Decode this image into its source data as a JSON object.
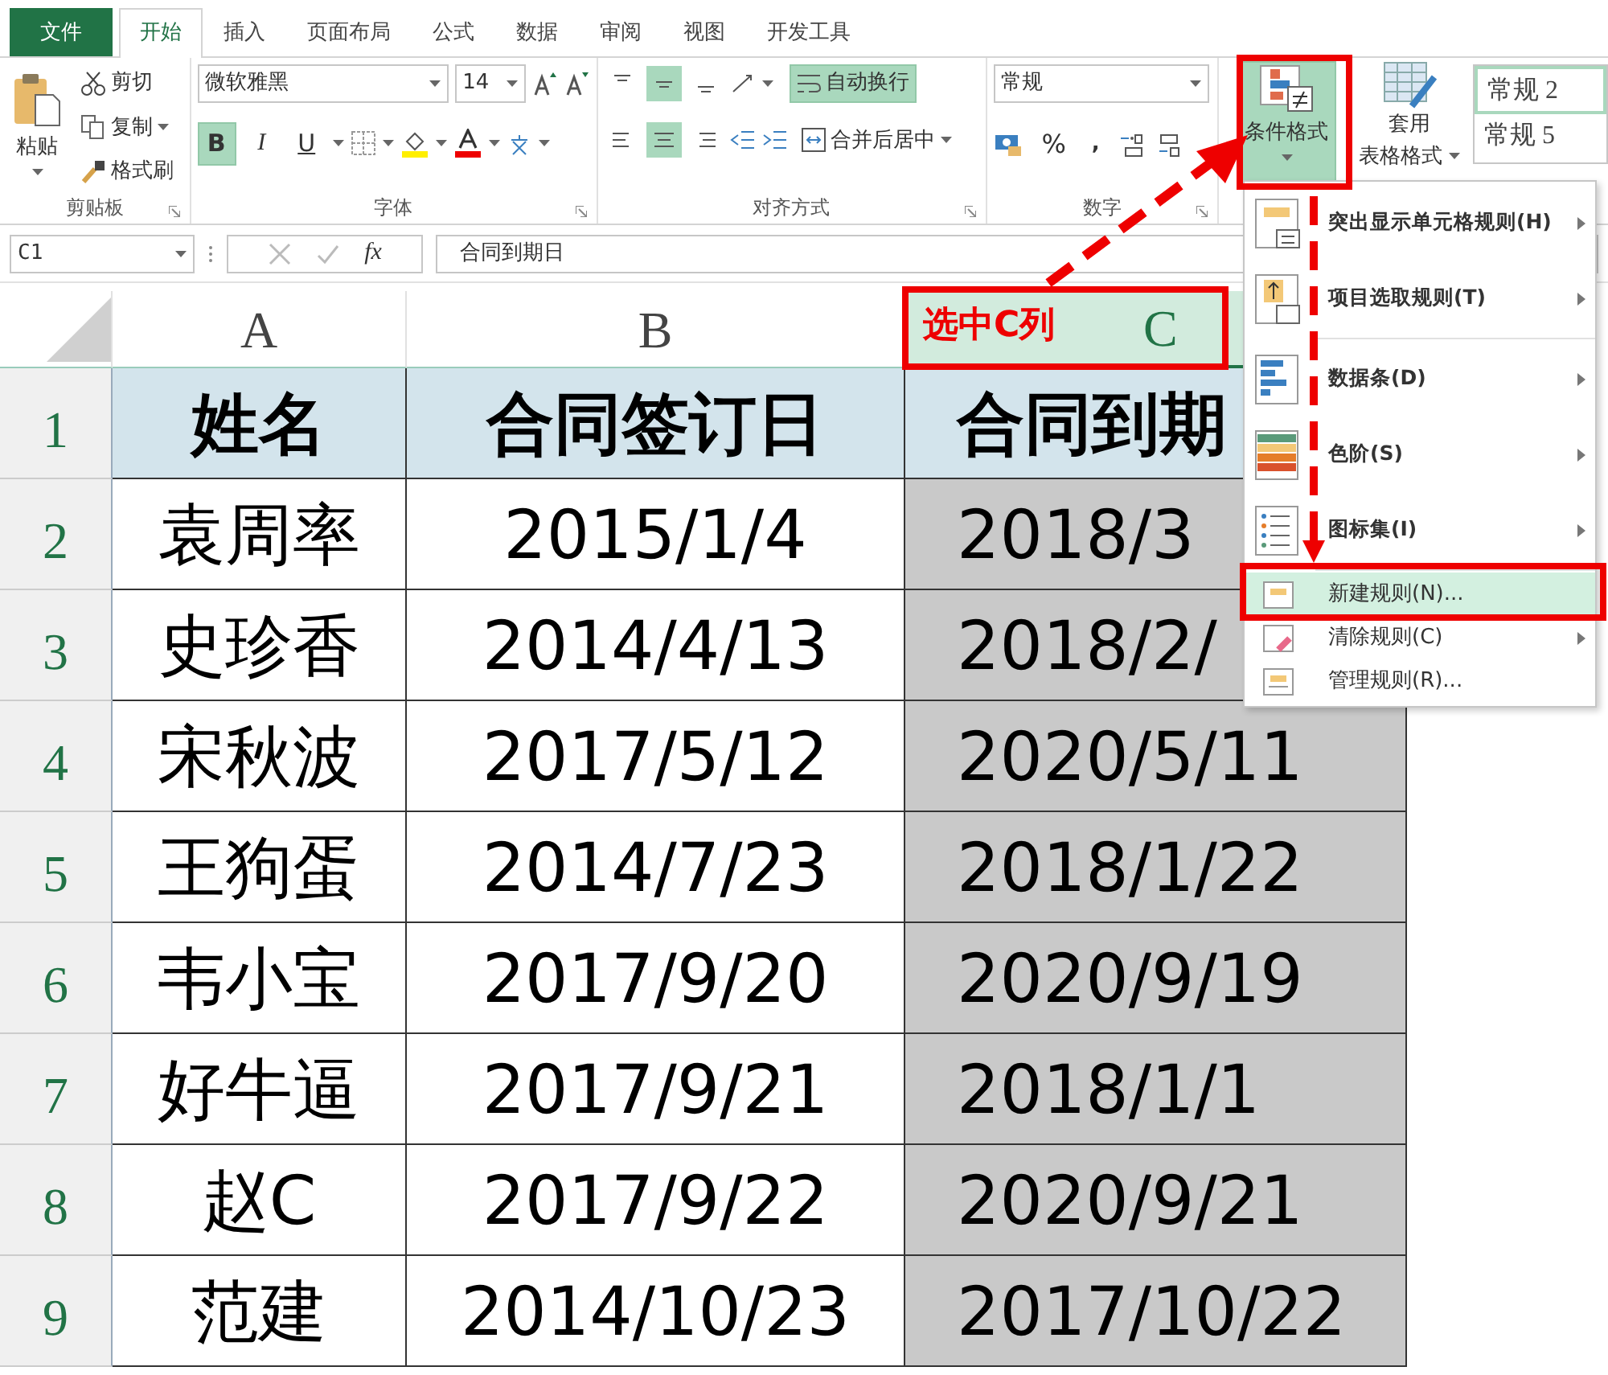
{
  "tabs": [
    {
      "label": "文件",
      "kind": "file",
      "selected": false
    },
    {
      "label": "开始",
      "kind": "tab",
      "selected": true
    },
    {
      "label": "插入",
      "kind": "tab",
      "selected": false
    },
    {
      "label": "页面布局",
      "kind": "tab",
      "selected": false
    },
    {
      "label": "公式",
      "kind": "tab",
      "selected": false
    },
    {
      "label": "数据",
      "kind": "tab",
      "selected": false
    },
    {
      "label": "审阅",
      "kind": "tab",
      "selected": false
    },
    {
      "label": "视图",
      "kind": "tab",
      "selected": false
    },
    {
      "label": "开发工具",
      "kind": "tab",
      "selected": false
    }
  ],
  "clipboard": {
    "paste": "粘贴",
    "cut": "剪切",
    "copy": "复制",
    "format_painter": "格式刷",
    "group": "剪贴板"
  },
  "font": {
    "name": "微软雅黑",
    "size": "14",
    "group": "字体",
    "toggles": [
      {
        "kind": "bold",
        "label": "B",
        "on": true
      },
      {
        "kind": "italic",
        "label": "I",
        "on": false
      },
      {
        "kind": "underline",
        "label": "U",
        "on": false
      }
    ]
  },
  "alignment": {
    "group": "对齐方式",
    "wrap_text": "自动换行",
    "wrap_on": true,
    "merge": "合并后居中",
    "vertical": [
      {
        "selected": false
      },
      {
        "selected": true
      },
      {
        "selected": false
      }
    ],
    "horizontal": [
      {
        "selected": false
      },
      {
        "selected": true
      },
      {
        "selected": false
      }
    ]
  },
  "number": {
    "group": "数字",
    "format": "常规",
    "percent": "%",
    "comma": ","
  },
  "styles": {
    "conditional_format": "条件格式",
    "table_format_lines": [
      "套用",
      "表格格式"
    ],
    "gallery": [
      "常规 2",
      "常规 5"
    ]
  },
  "formula_bar": {
    "name_box": "C1",
    "fx": "fx",
    "formula": "合同到期日"
  },
  "columns": [
    {
      "label": "A",
      "selected": false
    },
    {
      "label": "B",
      "selected": false
    },
    {
      "label": "C",
      "selected": true
    }
  ],
  "rows": [
    {
      "number": "1",
      "kind": "header",
      "cells": [
        "姓名",
        "合同签订日",
        "合同到期"
      ]
    },
    {
      "number": "2",
      "kind": "data",
      "cells": [
        "袁周率",
        "2015/1/4",
        "2018/3"
      ]
    },
    {
      "number": "3",
      "kind": "data",
      "cells": [
        "史珍香",
        "2014/4/13",
        "2018/2/"
      ]
    },
    {
      "number": "4",
      "kind": "data",
      "cells": [
        "宋秋波",
        "2017/5/12",
        "2020/5/11"
      ]
    },
    {
      "number": "5",
      "kind": "data",
      "cells": [
        "王狗蛋",
        "2014/7/23",
        "2018/1/22"
      ]
    },
    {
      "number": "6",
      "kind": "data",
      "cells": [
        "韦小宝",
        "2017/9/20",
        "2020/9/19"
      ]
    },
    {
      "number": "7",
      "kind": "data",
      "cells": [
        "好牛逼",
        "2017/9/21",
        "2018/1/1"
      ]
    },
    {
      "number": "8",
      "kind": "data",
      "cells": [
        "赵C",
        "2017/9/22",
        "2020/9/21"
      ]
    },
    {
      "number": "9",
      "kind": "data",
      "cells": [
        "范建",
        "2014/10/23",
        "2017/10/22"
      ]
    }
  ],
  "menu": {
    "items": [
      {
        "label": "突出显示单元格规则(H)",
        "kind": "highlight",
        "submenu": true,
        "selected": false
      },
      {
        "label": "项目选取规则(T)",
        "kind": "top",
        "submenu": true,
        "selected": false
      },
      {
        "label": "数据条(D)",
        "kind": "databar",
        "submenu": true,
        "selected": false
      },
      {
        "label": "色阶(S)",
        "kind": "colorscale",
        "submenu": true,
        "selected": false
      },
      {
        "label": "图标集(I)",
        "kind": "iconset",
        "submenu": true,
        "selected": false
      },
      {
        "label": "新建规则(N)...",
        "kind": "new",
        "submenu": false,
        "selected": true
      },
      {
        "label": "清除规则(C)",
        "kind": "clear",
        "submenu": true,
        "selected": false
      },
      {
        "label": "管理规则(R)...",
        "kind": "manage",
        "submenu": false,
        "selected": false
      }
    ]
  },
  "annotation": {
    "label": "选中C列"
  }
}
